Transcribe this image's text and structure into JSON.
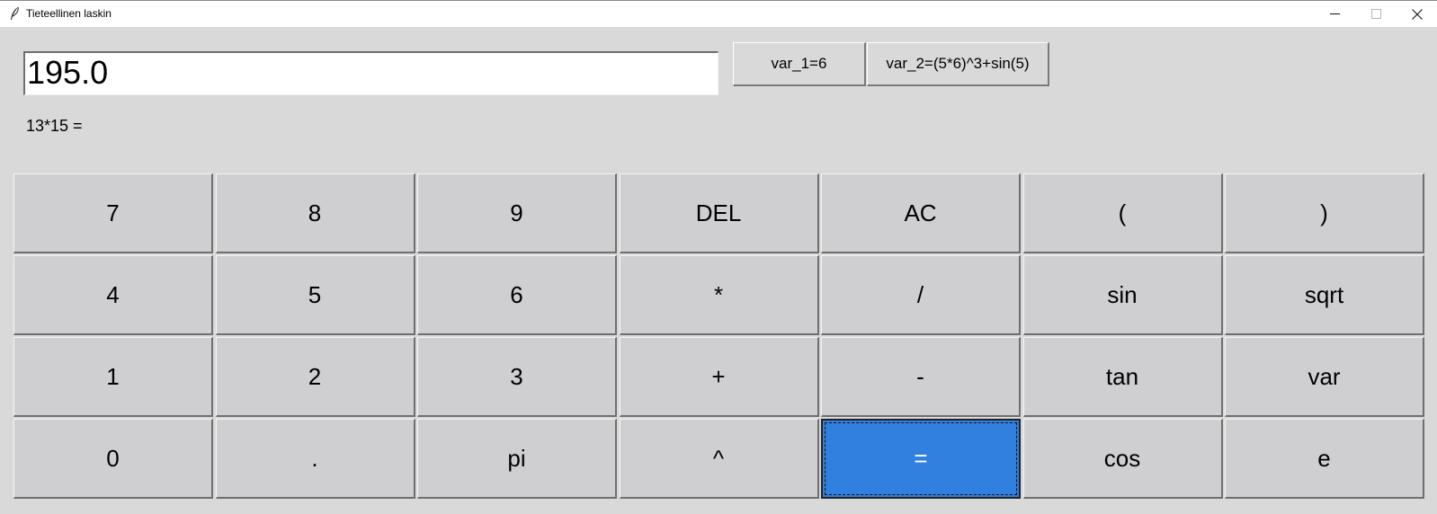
{
  "window": {
    "title": "Tieteellinen laskin"
  },
  "display": {
    "value": "195.0"
  },
  "expression": "13*15 =",
  "variables": [
    {
      "label": "var_1=6"
    },
    {
      "label": "var_2=(5*6)^3+sin(5)"
    }
  ],
  "keys": [
    [
      "7",
      "8",
      "9",
      "DEL",
      "AC",
      "(",
      ")"
    ],
    [
      "4",
      "5",
      "6",
      "*",
      "/",
      "sin",
      "sqrt"
    ],
    [
      "1",
      "2",
      "3",
      "+",
      "-",
      "tan",
      "var"
    ],
    [
      "0",
      ".",
      "pi",
      "^",
      "=",
      "cos",
      "e"
    ]
  ],
  "colors": {
    "background": "#d9d9d9",
    "key": "#cfcfd1",
    "accent": "#317fdf"
  }
}
